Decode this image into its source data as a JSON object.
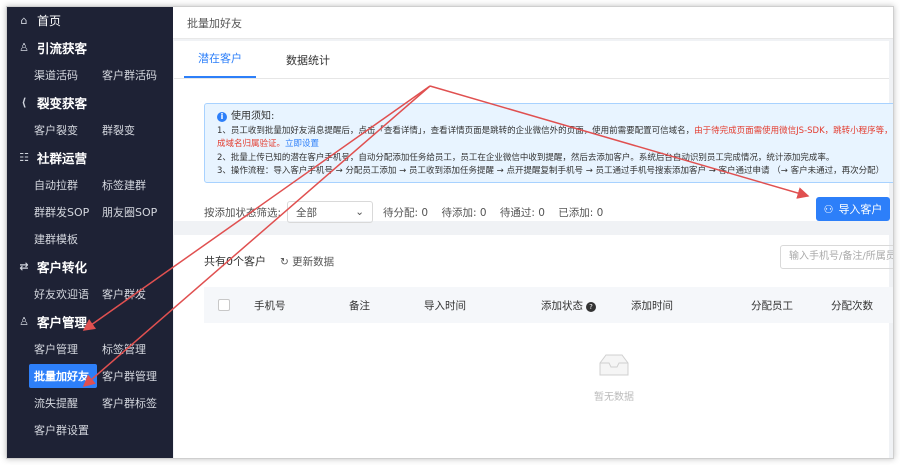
{
  "sidebar": {
    "home": "首页",
    "sections": [
      {
        "title": "引流获客",
        "icon": "user-icon",
        "rows": [
          [
            "渠道活码",
            "客户群活码"
          ]
        ]
      },
      {
        "title": "裂变获客",
        "icon": "share-icon",
        "rows": [
          [
            "客户裂变",
            "群裂变"
          ]
        ]
      },
      {
        "title": "社群运营",
        "icon": "group-icon",
        "rows": [
          [
            "自动拉群",
            "标签建群"
          ],
          [
            "群群发SOP",
            "朋友圈SOP"
          ],
          [
            "建群模板"
          ]
        ]
      },
      {
        "title": "客户转化",
        "icon": "conversion-icon",
        "rows": [
          [
            "好友欢迎语",
            "客户群发"
          ]
        ]
      },
      {
        "title": "客户管理",
        "icon": "customer-icon",
        "rows": [
          [
            "客户管理",
            "标签管理"
          ],
          [
            "批量加好友",
            "客户群管理"
          ],
          [
            "流失提醒",
            "客户群标签"
          ],
          [
            "客户群设置"
          ]
        ]
      }
    ],
    "active_item": "批量加好友"
  },
  "topbar": {
    "title": "批量加好友"
  },
  "tabs": [
    "潜在客户",
    "数据统计"
  ],
  "notice": {
    "title": "使用须知:",
    "line1": "1、员工收到批量加好友消息提醒后，点击「查看详情」，查看详情页面是跳转的企业微信外的页面，使用前需要配置可信域名，",
    "line1_red": "由于待完成页面需使用微信JS-SDK，跳转小程序等，更",
    "line1b_red": "成域名归属验证。",
    "line1b_link": "立即设置",
    "line2": "2、批量上传已知的潜在客户手机号，自动分配添加任务给员工，员工在企业微信中收到提醒，然后去添加客户。系统后台自动识别员工完成情况，统计添加完成率。",
    "line3": "3、操作流程：导入客户手机号 → 分配员工添加 → 员工收到添加任务提醒 → 点开提醒复制手机号 → 员工通过手机号搜索添加客户 → 客户通过申请 （→ 客户未通过，再次分配）"
  },
  "filter": {
    "label": "按添加状态筛选:",
    "select": "全部",
    "counts": [
      "待分配: 0",
      "待添加: 0",
      "待通过: 0",
      "已添加: 0"
    ]
  },
  "import_button": "导入客户",
  "list": {
    "total": "共有0个客户",
    "refresh": "更新数据",
    "search_placeholder": "输入手机号/备注/所属员工",
    "columns": [
      "手机号",
      "备注",
      "导入时间",
      "添加状态",
      "添加时间",
      "分配员工",
      "分配次数"
    ],
    "empty": "暂无数据"
  },
  "colors": {
    "sidebar": "#1e2235",
    "accent": "#2d7ff9",
    "arrow": "#e05050"
  }
}
